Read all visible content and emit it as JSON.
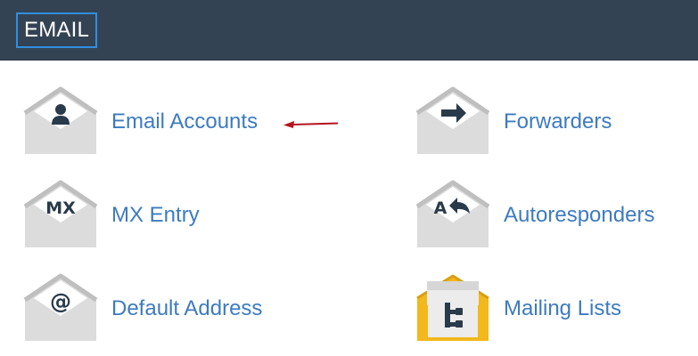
{
  "section": {
    "title": "EMAIL"
  },
  "items": [
    {
      "label": "Email Accounts",
      "icon": "user-envelope-icon"
    },
    {
      "label": "Forwarders",
      "icon": "forward-arrow-envelope-icon"
    },
    {
      "label": "MX Entry",
      "icon": "mx-envelope-icon",
      "glyph": "MX"
    },
    {
      "label": "Autoresponders",
      "icon": "autoreply-envelope-icon",
      "glyph": "A"
    },
    {
      "label": "Default Address",
      "icon": "at-sign-envelope-icon",
      "glyph": "@"
    },
    {
      "label": "Mailing Lists",
      "icon": "mailing-list-envelope-icon"
    }
  ],
  "colors": {
    "header_bg": "#344354",
    "header_focus_border": "#2f8fe0",
    "link": "#3d7bbf",
    "envelope": "#dcdcdc",
    "envelope_flap": "#bfbfbf",
    "glyph": "#293a4a",
    "mailing_list_accent": "#f2b81c",
    "annotation_arrow": "#b4141e"
  }
}
